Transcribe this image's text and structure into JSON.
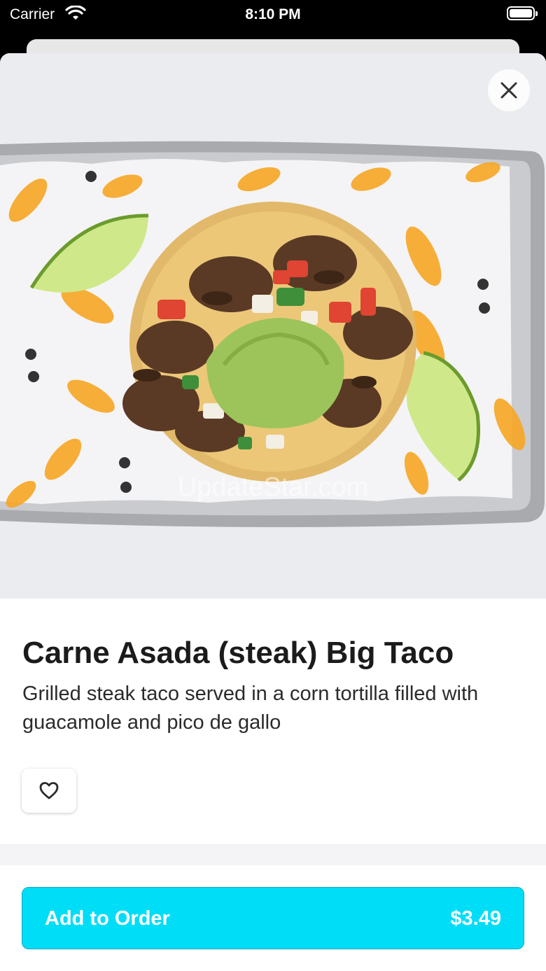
{
  "status_bar": {
    "carrier": "Carrier",
    "time": "8:10 PM"
  },
  "item": {
    "image_icon": "taco-photo",
    "title": "Carne Asada (steak) Big Taco",
    "description": "Grilled steak taco served in a corn tortilla filled with guacamole and pico de gallo"
  },
  "watermark": "UpdateStar.com",
  "actions": {
    "close_icon": "close-icon",
    "favorite_icon": "heart-icon",
    "add_label": "Add to Order",
    "price": "$3.49"
  },
  "colors": {
    "accent": "#00ddf7",
    "accent_border": "#0aa9c4",
    "title": "#1b1b1b"
  }
}
